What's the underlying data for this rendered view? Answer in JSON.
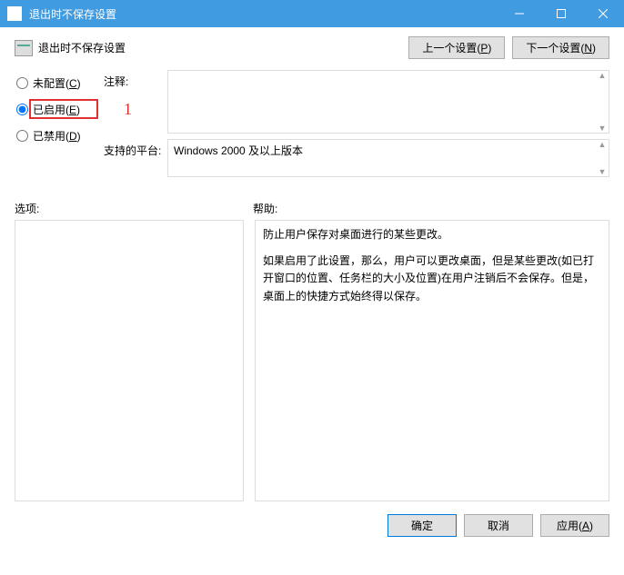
{
  "window": {
    "title": "退出时不保存设置"
  },
  "header": {
    "title": "退出时不保存设置"
  },
  "nav": {
    "prev": "上一个设置(",
    "prev_key": "P",
    "prev_suffix": ")",
    "next": "下一个设置(",
    "next_key": "N",
    "next_suffix": ")"
  },
  "radios": {
    "not_configured": "未配置(",
    "not_configured_key": "C",
    "not_configured_suffix": ")",
    "enabled": "已启用(",
    "enabled_key": "E",
    "enabled_suffix": ")",
    "disabled": "已禁用(",
    "disabled_key": "D",
    "disabled_suffix": ")"
  },
  "annotation": "1",
  "labels": {
    "comment": "注释:",
    "supported": "支持的平台:",
    "options": "选项:",
    "help": "帮助:"
  },
  "fields": {
    "comment": "",
    "supported": "Windows 2000 及以上版本"
  },
  "help": {
    "p1": "防止用户保存对桌面进行的某些更改。",
    "p2": "如果启用了此设置，那么，用户可以更改桌面，但是某些更改(如已打开窗口的位置、任务栏的大小及位置)在用户注销后不会保存。但是，桌面上的快捷方式始终得以保存。"
  },
  "buttons": {
    "ok": "确定",
    "cancel": "取消",
    "apply": "应用(",
    "apply_key": "A",
    "apply_suffix": ")"
  }
}
